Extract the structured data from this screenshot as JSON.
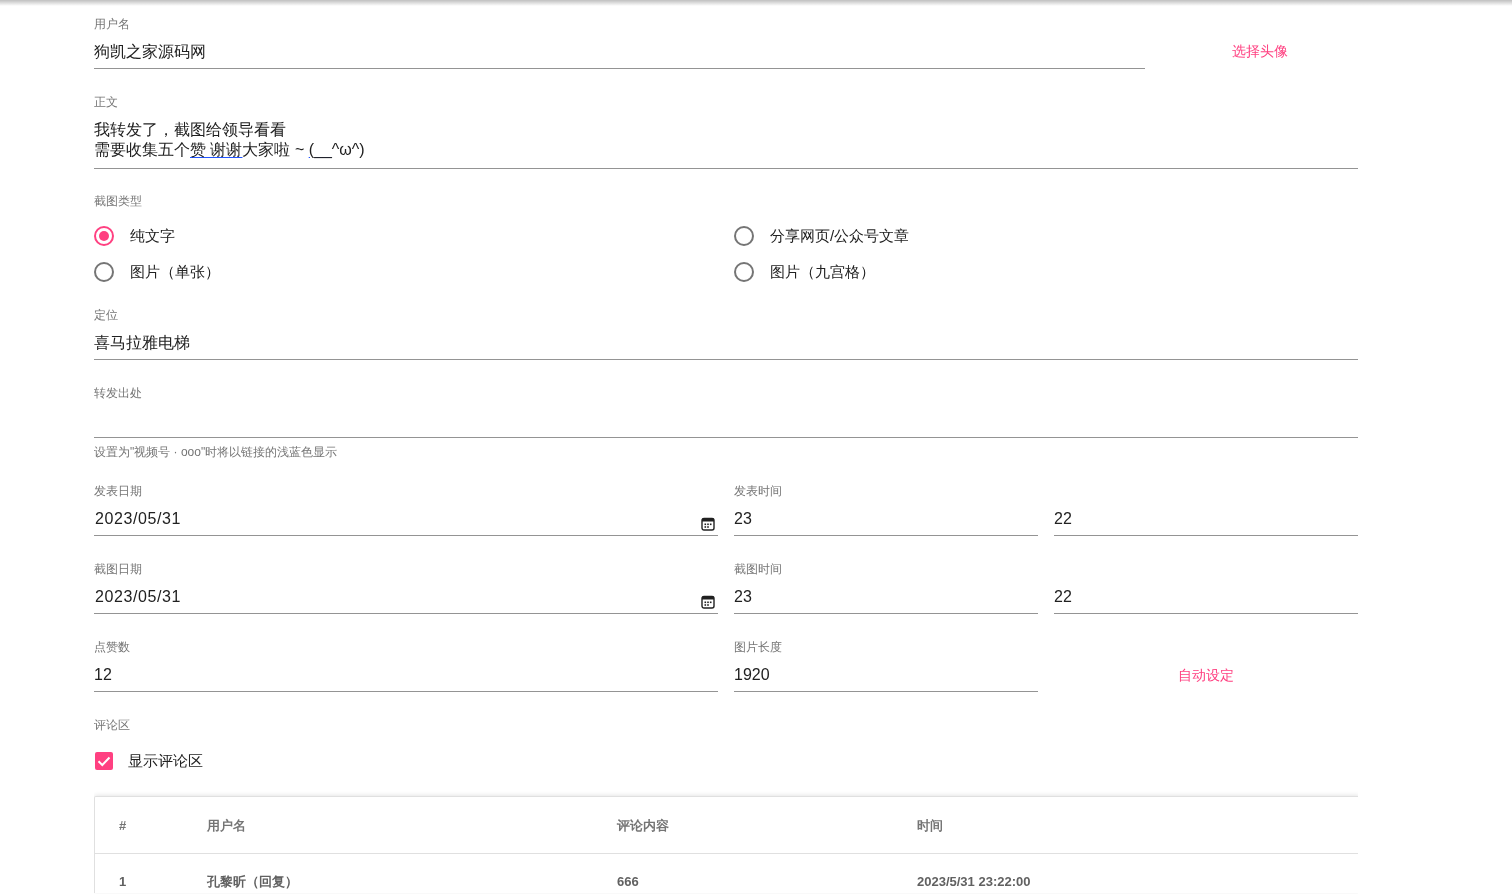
{
  "username": {
    "label": "用户名",
    "value": "狗凯之家源码网"
  },
  "choose_avatar_button": "选择头像",
  "body": {
    "label": "正文",
    "lines": [
      [
        {
          "text": "我转发了，截图给领导看看",
          "underlined": false
        }
      ],
      [
        {
          "text": "需要收集五个",
          "underlined": false
        },
        {
          "text": "赞 谢谢",
          "underlined": true
        },
        {
          "text": "大家啦 ~ ",
          "underlined": false
        },
        {
          "text": "(__",
          "underlined": true
        },
        {
          "text": "^ω^)",
          "underlined": false
        }
      ]
    ]
  },
  "screenshot_type": {
    "label": "截图类型",
    "options": [
      {
        "label": "纯文字",
        "selected": true
      },
      {
        "label": "分享网页/公众号文章",
        "selected": false
      },
      {
        "label": "图片（单张）",
        "selected": false
      },
      {
        "label": "图片（九宫格）",
        "selected": false
      }
    ]
  },
  "location": {
    "label": "定位",
    "value": "喜马拉雅电梯"
  },
  "forward_source": {
    "label": "转发出处",
    "helper": "设置为\"视频号 · ooo\"时将以链接的浅蓝色显示"
  },
  "date_rows": [
    {
      "date_label": "发表日期",
      "date": "2023/05/31",
      "time_label": "发表时间",
      "hour": "23",
      "minute": "22"
    },
    {
      "date_label": "截图日期",
      "date": "2023/05/31",
      "time_label": "截图时间",
      "hour": "23",
      "minute": "22"
    }
  ],
  "likes": {
    "label": "点赞数",
    "value": "12"
  },
  "image_length": {
    "label": "图片长度",
    "value": "1920"
  },
  "auto_set_button": "自动设定",
  "comments": {
    "label": "评论区",
    "show_checkbox": {
      "label": "显示评论区",
      "checked": true
    },
    "table": {
      "columns": [
        "#",
        "用户名",
        "评论内容",
        "时间"
      ],
      "rows": [
        [
          "1",
          "孔黎昕（回复）",
          "666",
          "2023/5/31 23:22:00"
        ]
      ]
    }
  }
}
